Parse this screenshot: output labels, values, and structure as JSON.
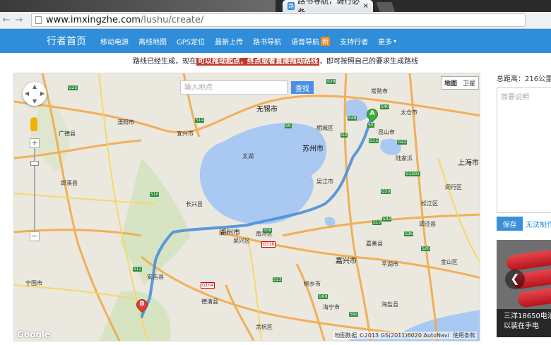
{
  "browser": {
    "tab_title": "路书导航，骑行必备",
    "tab_favicon": "路",
    "tab_close": "×",
    "back_icon": "←",
    "forward_icon": "→",
    "url_host": "www.imxingzhe.com",
    "url_path": "/lushu/create/"
  },
  "site_nav": {
    "logo": "行者首页",
    "items": [
      "移动电源",
      "离线地图",
      "GPS定位",
      "最新上传",
      "路书导航",
      "语音导航",
      "支持行者",
      "更多"
    ],
    "badge": "新",
    "more_caret": "▾"
  },
  "hint": {
    "before": "路线已经生成，现在",
    "highlight": "可以拖动起点，终点或者直接拖动路线",
    "after": "，即可按照自己的要求生成路线"
  },
  "map": {
    "search_placeholder": "输入地点",
    "search_button": "查找",
    "type_map": "地图",
    "type_satellite": "卫星",
    "copyright": "地图数据 ©2013 GS(2011)6020 AutoNavi",
    "terms": "使用条款",
    "logo": "Google",
    "zoom_in": "+",
    "zoom_out": "−",
    "marker_start": "A",
    "marker_end": "B",
    "cities": [
      "无锡市",
      "苏州市",
      "上海市",
      "湖州市",
      "嘉兴市",
      "吴江市",
      "太湖",
      "长兴县",
      "宜兴市",
      "溧阳市",
      "昆山市",
      "太仓市",
      "常熟市",
      "嘉善县",
      "平湖市",
      "海宁市",
      "桐乡市",
      "德清县",
      "安吉县",
      "广德县",
      "宁国市",
      "郎溪县",
      "余杭区",
      "金山区",
      "松江区",
      "闵行区",
      "南浔区",
      "吴兴区",
      "相城区",
      "陆家浜",
      "泗泾县",
      "海盐县"
    ],
    "shields": [
      "S39",
      "S40",
      "S48",
      "G42",
      "G2",
      "G15",
      "S5",
      "G50",
      "S36",
      "S17",
      "G1501",
      "S32",
      "S14",
      "S12",
      "S13",
      "G25",
      "S10",
      "G318",
      "S58",
      "S9",
      "G60",
      "S92",
      "S26",
      "G104"
    ],
    "route_color": "#4a90d9",
    "marker_a_color": "#3cae3c",
    "marker_b_color": "#d9413a"
  },
  "sidebar": {
    "distance": "总距离：216公里",
    "desc_placeholder": "简要说明",
    "save": "保存",
    "cannot_make": "无法制作",
    "ad_line1": "三洋18650电池",
    "ad_line2": "以装在手电",
    "ad_arrow": "❮"
  }
}
